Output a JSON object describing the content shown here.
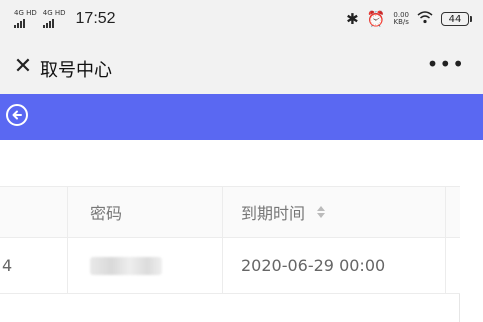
{
  "status_bar": {
    "signal1_label": "4G HD",
    "signal2_label": "4G HD",
    "time": "17:52",
    "bluetooth_icon": "bluetooth-icon",
    "alarm_icon": "alarm-icon",
    "speed_value": "0.00",
    "speed_unit": "KB/s",
    "wifi_icon": "wifi-icon",
    "battery_level": "44"
  },
  "title_bar": {
    "close_icon": "close-icon",
    "close_symbol": "✕",
    "title": "取号中心",
    "more_symbol": "•••"
  },
  "header": {
    "back_icon": "back-circle-arrow-icon",
    "accent_color": "#5a68f2"
  },
  "table": {
    "columns": [
      "",
      "密码",
      "到期时间",
      ""
    ],
    "sort_icon": "sort-icon",
    "rows": [
      {
        "col0": "4",
        "password_hidden": true,
        "expire_time": "2020-06-29 00:00"
      }
    ]
  }
}
